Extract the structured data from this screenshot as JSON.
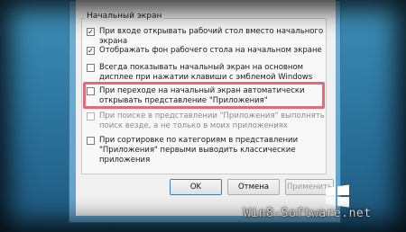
{
  "dialog": {
    "group_title": "Начальный экран",
    "options": [
      {
        "label": "При входе открывать рабочий стол вместо начального экрана",
        "checked": true,
        "enabled": true
      },
      {
        "label": "Отображать фон рабочего стола на начальном экране",
        "checked": true,
        "enabled": true
      },
      {
        "label": "Всегда показывать начальный экран на основном дисплее при нажатии клавиши с эмблемой Windows",
        "checked": false,
        "enabled": true
      },
      {
        "label": "При переходе на начальный экран автоматически открывать представление \"Приложения\"",
        "checked": false,
        "enabled": true
      },
      {
        "label": "При поиске в представлении \"Приложения\" выполнять поиск везде, а не только в моих приложениях",
        "checked": false,
        "enabled": false
      },
      {
        "label": "При сортировке по категориям в представлении \"Приложения\" первыми выводить классические приложения",
        "checked": false,
        "enabled": true
      }
    ],
    "buttons": {
      "ok": "OK",
      "cancel": "Отмена",
      "apply": "Применить"
    }
  },
  "watermark": "Win8-Software.net",
  "colors": {
    "highlight": "#e56a78",
    "desktop": "#2f7aa3"
  }
}
